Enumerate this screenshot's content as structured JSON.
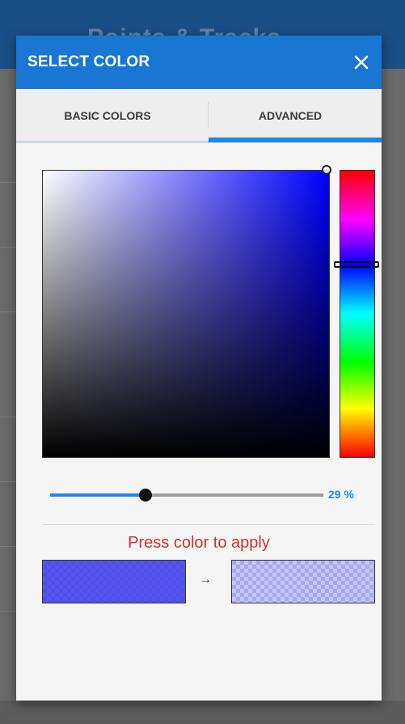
{
  "background_app": {
    "title": "Points & Tracks"
  },
  "dialog": {
    "title": "SELECT COLOR",
    "close_icon": "close-icon"
  },
  "tabs": [
    {
      "label": "BASIC COLORS",
      "selected": false
    },
    {
      "label": "ADVANCED",
      "selected": true
    }
  ],
  "picker": {
    "hue_color": "#0000ff",
    "hue_fraction": 0.33,
    "saturation": 1.0,
    "value": 1.0
  },
  "opacity": {
    "value": 29,
    "label": "29 %"
  },
  "hint": "Press color to apply",
  "swatches": {
    "current_color": "#5654f3",
    "new_color": "#a8a7f2",
    "arrow": "→"
  },
  "colors": {
    "accent": "#1976d2",
    "tab_indicator": "#1e88e5",
    "hint_text": "#d32f2f",
    "dialog_background": "#f5f5f5"
  }
}
